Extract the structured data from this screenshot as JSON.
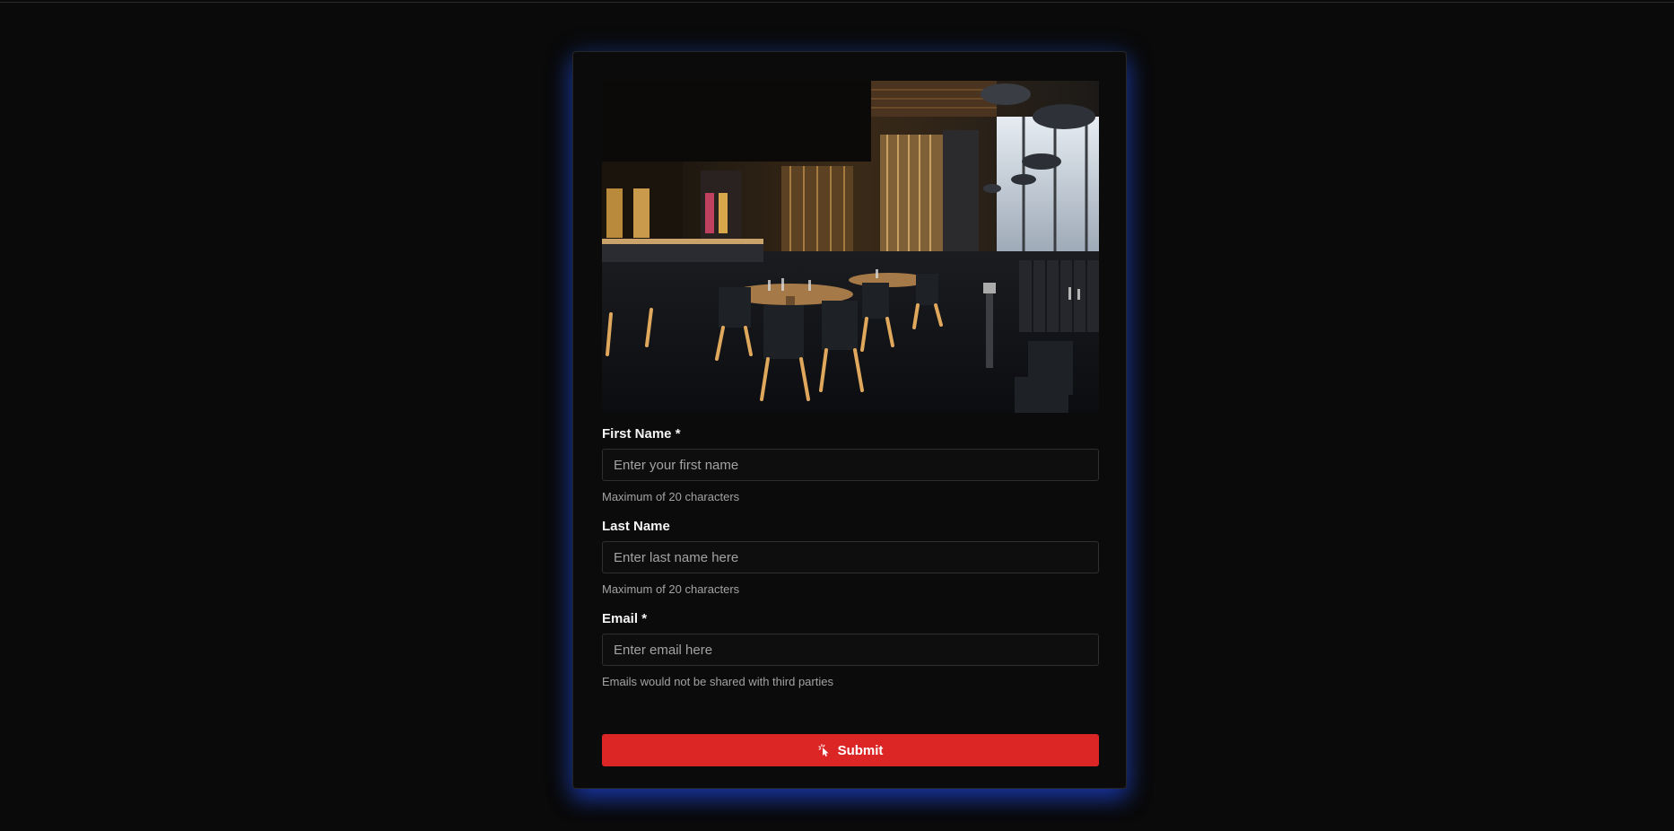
{
  "form": {
    "image": {
      "alt": "restaurant-interior"
    },
    "fields": [
      {
        "label": "First Name",
        "required_marker": "*",
        "placeholder": "Enter your first name",
        "value": "",
        "help": "Maximum of 20 characters"
      },
      {
        "label": "Last Name",
        "required_marker": "",
        "placeholder": "Enter last name here",
        "value": "",
        "help": "Maximum of 20 characters"
      },
      {
        "label": "Email",
        "required_marker": "*",
        "placeholder": "Enter email here",
        "value": "",
        "help": "Emails would not be shared with third parties"
      }
    ],
    "submit": {
      "label": "Submit",
      "icon": "pointer-click-icon"
    }
  },
  "colors": {
    "background": "#0a0a0a",
    "card": "#0b0b0b",
    "glow": "#2563eb",
    "submit": "#dc2626",
    "text": "#f5f5f5",
    "muted": "#a3a3a3"
  }
}
